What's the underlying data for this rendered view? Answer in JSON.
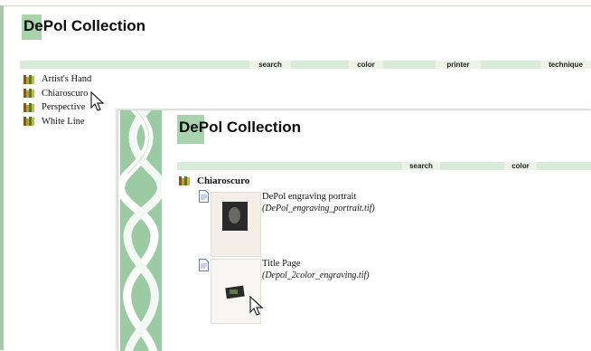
{
  "background_page": {
    "logo_title": "DePol Collection",
    "nav": [
      "search",
      "color",
      "printer",
      "technique"
    ],
    "sidebar_items": [
      "Artist's Hand",
      "Chiaroscuro",
      "Perspective",
      "White Line"
    ]
  },
  "foreground_page": {
    "logo_title": "DePol Collection",
    "nav": [
      "search",
      "color"
    ],
    "section_title": "Chiaroscuro",
    "items": [
      {
        "title": "DePol engraving portrait",
        "filename": "(DePol_engraving_portrait.tif)"
      },
      {
        "title": "Title Page",
        "filename": "(Depol_2color_engraving.tif)"
      }
    ]
  },
  "colors": {
    "accent_green": "#a8d3ad",
    "nav_band": "#d8ead8",
    "nav_tab": "#eef3e6"
  }
}
